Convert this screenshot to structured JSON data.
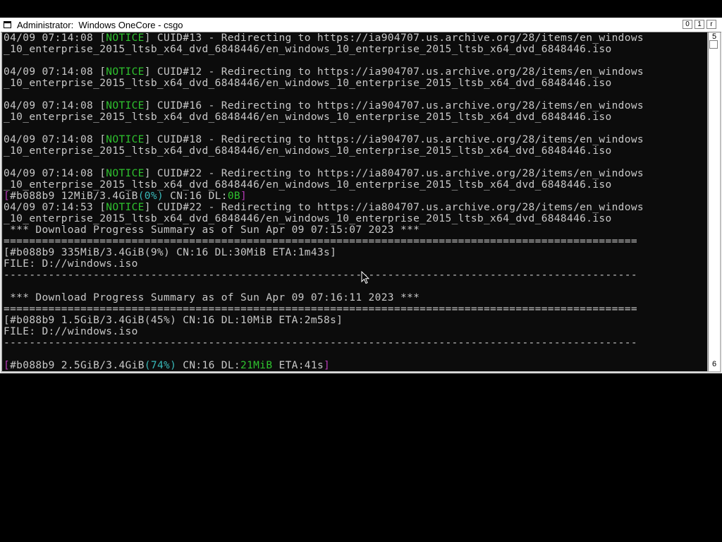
{
  "window": {
    "title": "Administrator:  Windows OneCore - csgo",
    "buttons": [
      "0",
      "1",
      "r"
    ]
  },
  "scrollbar": {
    "top_label": "5",
    "bottom_label": "6"
  },
  "console": {
    "lines": [
      [
        {
          "t": "04/09 07:14:08 ["
        },
        {
          "t": "NOTICE",
          "c": "g"
        },
        {
          "t": "] CUID#13 - Redirecting to https://ia904707.us.archive.org/28/items/en_windows"
        }
      ],
      [
        {
          "t": "_10_enterprise_2015_ltsb_x64_dvd_6848446/en_windows_10_enterprise_2015_ltsb_x64_dvd_6848446.iso"
        }
      ],
      [
        {
          "t": ""
        }
      ],
      [
        {
          "t": "04/09 07:14:08 ["
        },
        {
          "t": "NOTICE",
          "c": "g"
        },
        {
          "t": "] CUID#12 - Redirecting to https://ia904707.us.archive.org/28/items/en_windows"
        }
      ],
      [
        {
          "t": "_10_enterprise_2015_ltsb_x64_dvd_6848446/en_windows_10_enterprise_2015_ltsb_x64_dvd_6848446.iso"
        }
      ],
      [
        {
          "t": ""
        }
      ],
      [
        {
          "t": "04/09 07:14:08 ["
        },
        {
          "t": "NOTICE",
          "c": "g"
        },
        {
          "t": "] CUID#16 - Redirecting to https://ia904707.us.archive.org/28/items/en_windows"
        }
      ],
      [
        {
          "t": "_10_enterprise_2015_ltsb_x64_dvd_6848446/en_windows_10_enterprise_2015_ltsb_x64_dvd_6848446.iso"
        }
      ],
      [
        {
          "t": ""
        }
      ],
      [
        {
          "t": "04/09 07:14:08 ["
        },
        {
          "t": "NOTICE",
          "c": "g"
        },
        {
          "t": "] CUID#18 - Redirecting to https://ia904707.us.archive.org/28/items/en_windows"
        }
      ],
      [
        {
          "t": "_10_enterprise_2015_ltsb_x64_dvd_6848446/en_windows_10_enterprise_2015_ltsb_x64_dvd_6848446.iso"
        }
      ],
      [
        {
          "t": ""
        }
      ],
      [
        {
          "t": "04/09 07:14:08 ["
        },
        {
          "t": "NOTICE",
          "c": "g"
        },
        {
          "t": "] CUID#22 - Redirecting to https://ia804707.us.archive.org/28/items/en_windows"
        }
      ],
      [
        {
          "t": "_10_enterprise_2015_ltsb_x64_dvd_6848446/en_windows_10_enterprise_2015_ltsb_x64_dvd_6848446.iso"
        }
      ],
      [
        {
          "t": "[",
          "c": "m"
        },
        {
          "t": "#b088b9 12MiB/3.4GiB"
        },
        {
          "t": "(0%)",
          "c": "c"
        },
        {
          "t": " CN:16 DL:"
        },
        {
          "t": "0B",
          "c": "g"
        },
        {
          "t": "]",
          "c": "m"
        }
      ],
      [
        {
          "t": "04/09 07:14:53 ["
        },
        {
          "t": "NOTICE",
          "c": "g"
        },
        {
          "t": "] CUID#22 - Redirecting to https://ia804707.us.archive.org/28/items/en_windows"
        }
      ],
      [
        {
          "t": "_10_enterprise_2015_ltsb_x64_dvd_6848446/en_windows_10_enterprise_2015_ltsb_x64_dvd_6848446.iso"
        }
      ],
      [
        {
          "t": " *** Download Progress Summary as of Sun Apr 09 07:15:07 2023 ***"
        }
      ],
      [
        {
          "t": "==================================================================================================="
        }
      ],
      [
        {
          "t": "[#b088b9 335MiB/3.4GiB(9%) CN:16 DL:30MiB ETA:1m43s]"
        }
      ],
      [
        {
          "t": "FILE: D://windows.iso"
        }
      ],
      [
        {
          "t": "---------------------------------------------------------------------------------------------------"
        }
      ],
      [
        {
          "t": ""
        }
      ],
      [
        {
          "t": " *** Download Progress Summary as of Sun Apr 09 07:16:11 2023 ***"
        }
      ],
      [
        {
          "t": "==================================================================================================="
        }
      ],
      [
        {
          "t": "[#b088b9 1.5GiB/3.4GiB(45%) CN:16 DL:10MiB ETA:2m58s]"
        }
      ],
      [
        {
          "t": "FILE: D://windows.iso"
        }
      ],
      [
        {
          "t": "---------------------------------------------------------------------------------------------------"
        }
      ],
      [
        {
          "t": ""
        }
      ],
      [
        {
          "t": "[",
          "c": "m"
        },
        {
          "t": "#b088b9 2.5GiB/3.4GiB"
        },
        {
          "t": "(74%)",
          "c": "c"
        },
        {
          "t": " CN:16 DL:"
        },
        {
          "t": "21MiB",
          "c": "g"
        },
        {
          "t": " ETA:41s"
        },
        {
          "t": "]",
          "c": "m"
        }
      ]
    ]
  },
  "colors": {
    "background": "#0c0c0c",
    "text": "#c8c8c8",
    "notice": "#2ec22e",
    "percent": "#38b8b8",
    "bracket": "#b83ab8"
  },
  "cursor": {
    "icon": "arrow-pointer-icon"
  }
}
